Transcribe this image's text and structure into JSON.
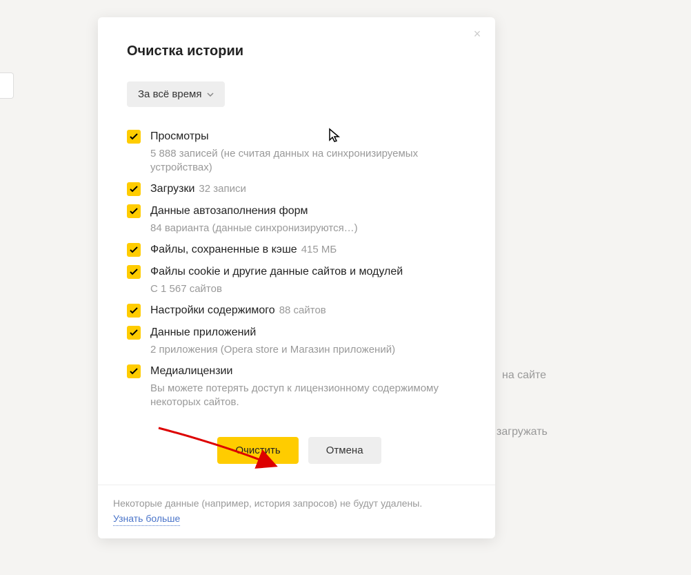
{
  "background": {
    "text1": "на сайте",
    "text2": "загружать"
  },
  "dialog": {
    "title": "Очистка истории",
    "timeSelect": "За всё время",
    "options": [
      {
        "label": "Просмотры",
        "sub": "5 888 записей (не считая данных на синхронизируемых устройствах)",
        "inline": null
      },
      {
        "label": "Загрузки",
        "sub": null,
        "inline": "32 записи"
      },
      {
        "label": "Данные автозаполнения форм",
        "sub": "84 варианта (данные синхронизируются…)",
        "inline": null
      },
      {
        "label": "Файлы, сохраненные в кэше",
        "sub": null,
        "inline": "415 МБ"
      },
      {
        "label": "Файлы cookie и другие данные сайтов и модулей",
        "sub": "С 1 567 сайтов",
        "inline": null
      },
      {
        "label": "Настройки содержимого",
        "sub": null,
        "inline": "88 сайтов"
      },
      {
        "label": "Данные приложений",
        "sub": "2 приложения (Opera store и Магазин приложений)",
        "inline": null
      },
      {
        "label": "Медиалицензии",
        "sub": "Вы можете потерять доступ к лицензионному содержимому некоторых сайтов.",
        "inline": null
      }
    ],
    "buttons": {
      "clear": "Очистить",
      "cancel": "Отмена"
    },
    "footer": {
      "text": "Некоторые данные (например, история запросов) не будут удалены.",
      "link": "Узнать больше"
    }
  }
}
